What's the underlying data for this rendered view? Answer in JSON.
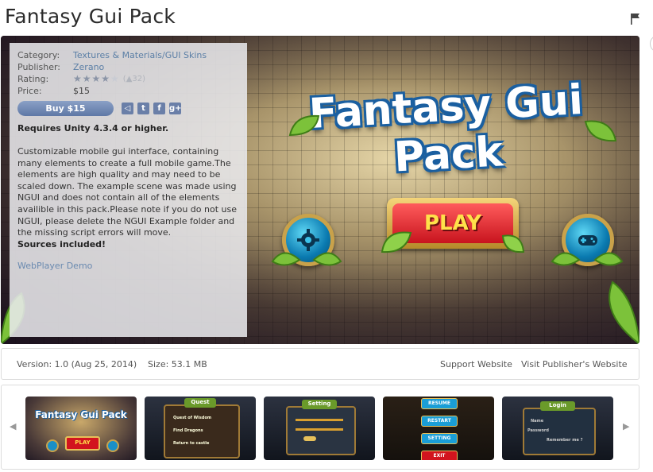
{
  "page": {
    "title": "Fantasy Gui Pack"
  },
  "details": {
    "category_label": "Category:",
    "category_value": "Textures & Materials/GUI Skins",
    "publisher_label": "Publisher:",
    "publisher_value": "Zerano",
    "rating_label": "Rating:",
    "rating_stars": 4,
    "rating_count": "32",
    "price_label": "Price:",
    "price_value": "$15",
    "buy_label": "Buy $15",
    "share": [
      "unity",
      "twitter",
      "facebook",
      "google-plus"
    ],
    "requires": "Requires Unity 4.3.4 or higher.",
    "description": "Customizable mobile gui interface, containing many elements to create a full mobile game.The elements are high quality and may need to be scaled down. The example scene was made using NGUI and does not contain all of the elements availible in this pack.Please note if you do not use NGUI, please delete the NGUI Example folder and the missing script errors will move.",
    "sources": "Sources included!",
    "webplayer": "WebPlayer Demo"
  },
  "hero": {
    "logo": "Fantasy Gui Pack",
    "play": "PLAY",
    "left_icon": "gear-icon",
    "right_icon": "gamepad-icon"
  },
  "info_bar": {
    "version": "Version: 1.0 (Aug 25, 2014)",
    "size": "Size: 53.1 MB",
    "support": "Support Website",
    "publisher_site": "Visit Publisher's Website"
  },
  "thumbnails": {
    "prev": "◀",
    "next": "▶",
    "items": [
      {
        "title": "Fantasy Gui Pack",
        "button": "PLAY"
      },
      {
        "title": "Quest",
        "rows": [
          "Quest of Wisdom",
          "Find Dragons",
          "Return to castle"
        ]
      },
      {
        "title": "Setting"
      },
      {
        "buttons": [
          "RESUME",
          "RESTART",
          "SETTING",
          "EXIT"
        ]
      },
      {
        "title": "Login",
        "fields": [
          "Name",
          "Password"
        ],
        "remember": "Remember me ?"
      }
    ]
  },
  "colors": {
    "link": "#5b7fa6",
    "buy": "#6f86b2"
  }
}
